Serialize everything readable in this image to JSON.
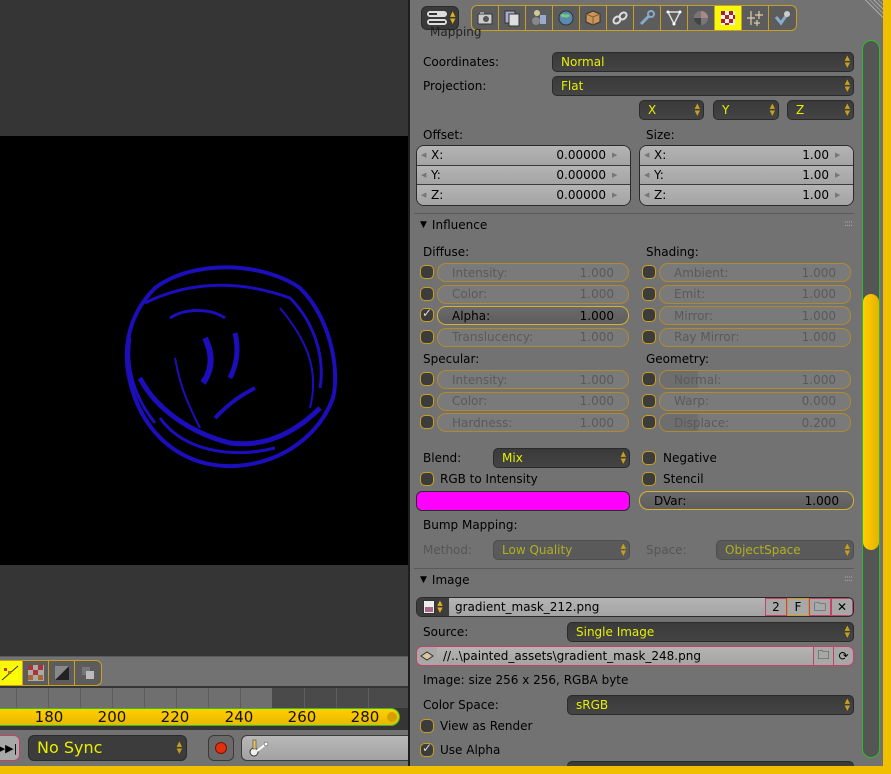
{
  "colors": {
    "accent": "#f0c000",
    "dropdown_text": "#e6f000",
    "swatch": "#ff00ff",
    "render_blob": "#2010d0"
  },
  "properties": {
    "header": {
      "context_selector_icon": "editor-type-icon",
      "tabs": [
        {
          "icon": "render-icon",
          "active": false
        },
        {
          "icon": "render-layers-icon",
          "active": false
        },
        {
          "icon": "scene-icon",
          "active": false
        },
        {
          "icon": "world-icon",
          "active": false
        },
        {
          "icon": "object-icon",
          "active": false
        },
        {
          "icon": "constraints-icon",
          "active": false
        },
        {
          "icon": "modifiers-icon",
          "active": false
        },
        {
          "icon": "data-icon",
          "active": false
        },
        {
          "icon": "material-icon",
          "active": false
        },
        {
          "icon": "texture-icon",
          "active": true
        },
        {
          "icon": "particles-icon",
          "active": false
        },
        {
          "icon": "physics-icon",
          "active": false
        }
      ]
    },
    "mapping": {
      "title": "Mapping",
      "coordinates_label": "Coordinates:",
      "coordinates_value": "Normal",
      "projection_label": "Projection:",
      "projection_value": "Flat",
      "axis_x": "X",
      "axis_y": "Y",
      "axis_z": "Z",
      "offset_label": "Offset:",
      "offset": [
        {
          "k": "X:",
          "v": "0.00000"
        },
        {
          "k": "Y:",
          "v": "0.00000"
        },
        {
          "k": "Z:",
          "v": "0.00000"
        }
      ],
      "size_label": "Size:",
      "size": [
        {
          "k": "X:",
          "v": "1.00"
        },
        {
          "k": "Y:",
          "v": "1.00"
        },
        {
          "k": "Z:",
          "v": "1.00"
        }
      ]
    },
    "influence": {
      "title": "Influence",
      "diffuse_label": "Diffuse:",
      "diffuse": [
        {
          "k": "Intensity:",
          "v": "1.000",
          "checked": false
        },
        {
          "k": "Color:",
          "v": "1.000",
          "checked": false
        },
        {
          "k": "Alpha:",
          "v": "1.000",
          "checked": true
        },
        {
          "k": "Translucency:",
          "v": "1.000",
          "checked": false
        }
      ],
      "shading_label": "Shading:",
      "shading": [
        {
          "k": "Ambient:",
          "v": "1.000",
          "checked": false
        },
        {
          "k": "Emit:",
          "v": "1.000",
          "checked": false
        },
        {
          "k": "Mirror:",
          "v": "1.000",
          "checked": false
        },
        {
          "k": "Ray Mirror:",
          "v": "1.000",
          "checked": false
        }
      ],
      "specular_label": "Specular:",
      "specular": [
        {
          "k": "Intensity:",
          "v": "1.000",
          "checked": false
        },
        {
          "k": "Color:",
          "v": "1.000",
          "checked": false
        },
        {
          "k": "Hardness:",
          "v": "1.000",
          "checked": false
        }
      ],
      "geometry_label": "Geometry:",
      "geometry": [
        {
          "k": "Normal:",
          "v": "1.000",
          "checked": false,
          "fill": 0.2
        },
        {
          "k": "Warp:",
          "v": "0.000",
          "checked": false,
          "fill": 0.0
        },
        {
          "k": "Displace:",
          "v": "0.200",
          "checked": false,
          "fill": 0.2
        }
      ],
      "blend_label": "Blend:",
      "blend_value": "Mix",
      "negative_label": "Negative",
      "rgb_to_intensity_label": "RGB to Intensity",
      "stencil_label": "Stencil",
      "dvar_label": "DVar:",
      "dvar_value": "1.000",
      "bump_label": "Bump Mapping:",
      "method_label": "Method:",
      "method_value": "Low Quality",
      "space_label": "Space:",
      "space_value": "ObjectSpace"
    },
    "image": {
      "title": "Image",
      "datablock_name": "gradient_mask_212.png",
      "users": "2",
      "fake_user": "F",
      "source_label": "Source:",
      "source_value": "Single Image",
      "filepath": "//..\\painted_assets\\gradient_mask_248.png",
      "info": "Image: size 256 x 256, RGBA byte",
      "color_space_label": "Color Space:",
      "color_space_value": "sRGB",
      "view_as_render_label": "View as Render",
      "use_alpha_label": "Use Alpha"
    },
    "scroll_position": 0.55
  },
  "timeline": {
    "ticks": [
      "180",
      "200",
      "220",
      "240",
      "260",
      "280"
    ],
    "sync_value": "No Sync"
  }
}
